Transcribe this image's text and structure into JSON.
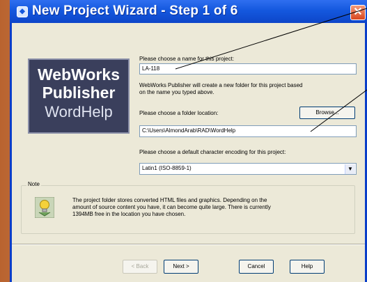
{
  "window": {
    "title": "New Project Wizard - Step 1 of 6",
    "close_glyph": "✕"
  },
  "logo": {
    "line1": "WebWorks",
    "line2": "Publisher",
    "line3": "WordHelp"
  },
  "project_name": {
    "label": "Please choose a name for this project:",
    "value": "LA-118"
  },
  "folder_info": {
    "text": "WebWorks Publisher will create a new folder for this project based on the name you typed above."
  },
  "folder_location": {
    "label": "Please choose a folder location:",
    "value": "C:\\Users\\AlmondArab\\RAD\\WordHelp",
    "browse_label": "Browse..."
  },
  "encoding": {
    "label": "Please choose a default character encoding for this project:",
    "value": "Latin1 (ISO-8859-1)"
  },
  "note": {
    "legend": "Note",
    "text": "The project folder stores converted HTML files and graphics. Depending on the amount of source content you have, it can become quite large. There is currently 1394MB free in the location you have chosen."
  },
  "buttons": {
    "back": "< Back",
    "next": "Next >",
    "cancel": "Cancel",
    "help": "Help"
  },
  "icons": {
    "title": "wizard-window-icon",
    "note": "lightbulb-icon",
    "dropdown": "chevron-down-icon"
  }
}
